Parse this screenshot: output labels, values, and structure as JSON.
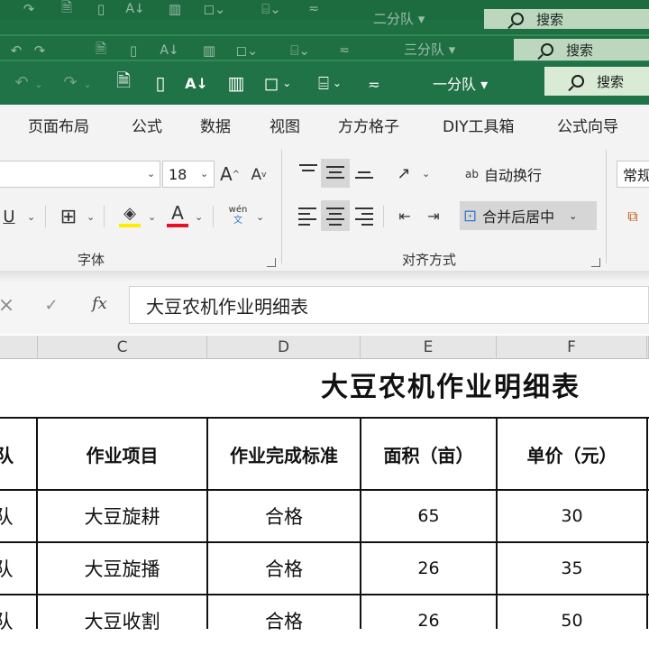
{
  "windows": [
    {
      "team": "一分队",
      "search": "搜索"
    },
    {
      "team": "三分队",
      "search": "搜索"
    },
    {
      "team": "二分队",
      "search": "搜索"
    }
  ],
  "quick_access_icons": [
    "undo-icon",
    "redo-icon",
    "print-preview-icon",
    "new-file-icon",
    "sort-az-icon",
    "chart-icon",
    "shapes-icon",
    "text-box-icon",
    "customize-icon"
  ],
  "menu": [
    "页面布局",
    "公式",
    "数据",
    "视图",
    "方方格子",
    "DIY工具箱",
    "公式向导"
  ],
  "ribbon": {
    "font_size": "18",
    "grow_font": "A",
    "shrink_font": "A",
    "underline": "U",
    "font_color_letter": "A",
    "phonetic_top": "wén",
    "phonetic_bottom": "文",
    "wrap_text": "自动换行",
    "wrap_icon_text": "ab",
    "merge_center": "合并后居中",
    "number_format": "常规",
    "group_font": "字体",
    "group_alignment": "对齐方式",
    "accent_yellow": "#ffee00",
    "accent_red": "#e81123"
  },
  "formula_bar": {
    "cancel": "×",
    "confirm": "✓",
    "fx": "fx",
    "content": "大豆农机作业明细表"
  },
  "columns": [
    "C",
    "D",
    "E",
    "F"
  ],
  "sheet": {
    "title": "大豆农机作业明细表",
    "headers": [
      "队",
      "作业项目",
      "作业完成标准",
      "面积（亩）",
      "单价（元）"
    ],
    "rows": [
      [
        "队",
        "大豆旋耕",
        "合格",
        "65",
        "30"
      ],
      [
        "队",
        "大豆旋播",
        "合格",
        "26",
        "35"
      ],
      [
        "队",
        "大豆收割",
        "合格",
        "26",
        "50"
      ]
    ]
  }
}
